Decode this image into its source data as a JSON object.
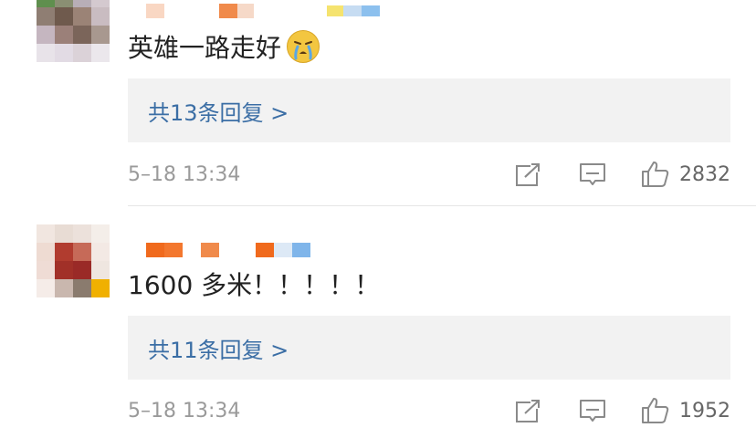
{
  "comments": [
    {
      "text": "英雄一路走好",
      "emoji": "crying-face-emoji",
      "replies_label": "共13条回复 >",
      "time": "5–18 13:34",
      "likes": "2832",
      "name_colors": [
        "#f9d7c3",
        "#f08a4b",
        "#f6d9c8",
        "#f5e36f",
        "#c6dcf2"
      ]
    },
    {
      "text": "1600 多米！！！！！",
      "replies_label": "共11条回复 >",
      "time": "5–18 13:34",
      "likes": "1952",
      "name_colors": [
        "#f06a1d",
        "#f3772e",
        "#f08a4b",
        "#f06a1d",
        "#dde9f6",
        "#7fb5ea"
      ]
    }
  ],
  "icons": {
    "share": "share-icon",
    "reply": "comment-icon",
    "like": "thumbs-up-icon"
  },
  "colors": {
    "reply_link": "#3b6ea5",
    "reply_bg": "#f2f2f2",
    "meta_text": "#9a9a9a"
  }
}
